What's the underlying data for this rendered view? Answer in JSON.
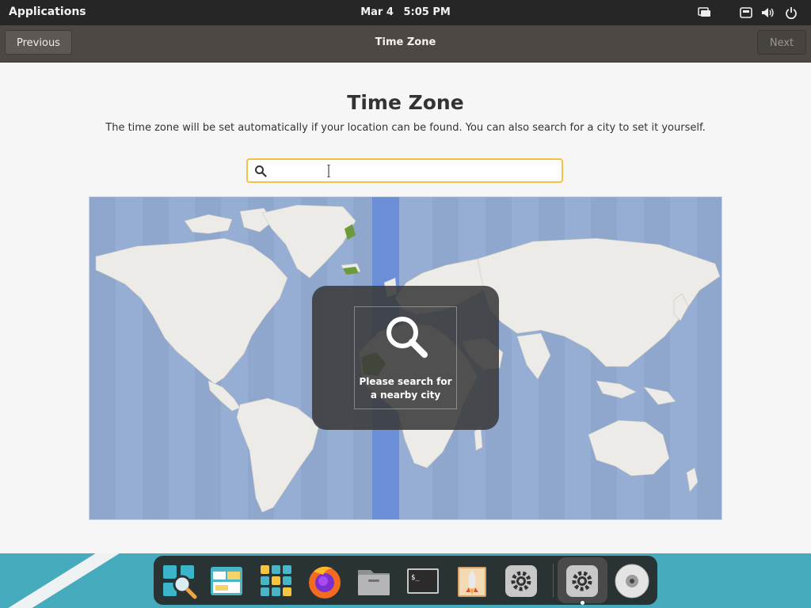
{
  "topbar": {
    "applications_label": "Applications",
    "date": "Mar 4",
    "time": "5:05 PM",
    "tray_icons": [
      "network-wired-icon",
      "keyboard-layout-icon",
      "volume-icon",
      "power-icon"
    ]
  },
  "header": {
    "title": "Time Zone",
    "previous_label": "Previous",
    "next_label": "Next"
  },
  "content": {
    "title": "Time Zone",
    "description": "The time zone will be set automatically if your location can be found. You can also search for a city to set it yourself.",
    "search": {
      "value": "",
      "placeholder": ""
    },
    "overlay_message": "Please search for a nearby city"
  },
  "dock": {
    "apps": [
      "search-app-icon",
      "files-app-icon",
      "app-grid-icon",
      "firefox-icon",
      "file-manager-icon",
      "terminal-icon",
      "installer-icon",
      "settings-icon",
      "settings-active-icon",
      "disc-icon"
    ]
  },
  "colors": {
    "accent": "#f6c042",
    "header_bg": "#4d4843",
    "map_water": "#96aed3",
    "selected_zone": "#6b8fd6",
    "dock_bg": "#46abbd"
  }
}
